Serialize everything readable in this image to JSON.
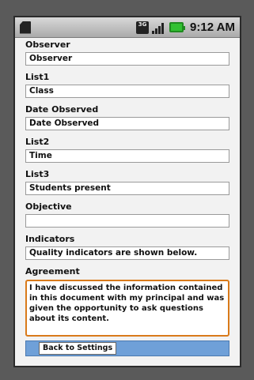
{
  "status_bar": {
    "time": "9:12 AM",
    "network_label": "3G",
    "icons": [
      "sd-card-icon",
      "network-3g-icon",
      "signal-icon",
      "battery-icon"
    ]
  },
  "form": {
    "observer": {
      "label": "Observer",
      "value": "Observer"
    },
    "list1": {
      "label": "List1",
      "value": "Class"
    },
    "date_observed": {
      "label": "Date Observed",
      "value": "Date Observed"
    },
    "list2": {
      "label": "List2",
      "value": "Time"
    },
    "list3": {
      "label": "List3",
      "value": "Students present"
    },
    "objective": {
      "label": "Objective",
      "value": ""
    },
    "indicators": {
      "label": "Indicators",
      "value": "Quality indicators are shown below."
    },
    "agreement": {
      "label": "Agreement",
      "value": "I have discussed the information contained in this document with my principal and was given the opportunity to ask questions about its content."
    }
  },
  "footer": {
    "back_label": "Back to Settings"
  },
  "colors": {
    "focus_border": "#d97a1a",
    "footer_bar": "#6fa0d8",
    "battery": "#32c132"
  }
}
